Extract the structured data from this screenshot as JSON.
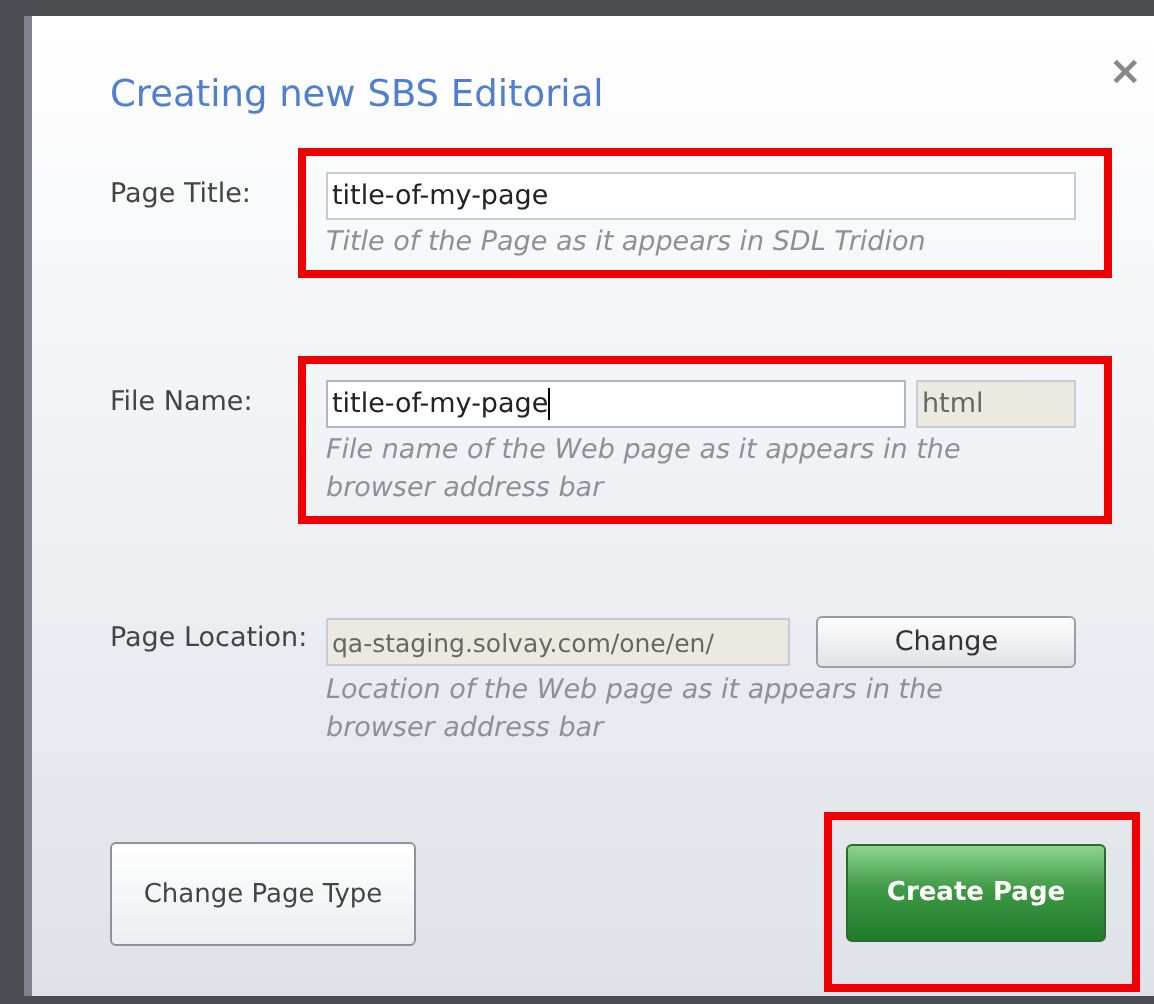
{
  "dialog": {
    "title": "Creating new SBS Editorial",
    "close": "×",
    "fields": [
      {
        "kind": "text",
        "label": "Page Title:",
        "value": "title-of-my-page",
        "focused": false,
        "hint": "Title of the Page as it appears in SDL Tridion",
        "highlighted": true
      },
      {
        "kind": "text_with_extension",
        "label": "File Name:",
        "value": "title-of-my-page",
        "extension": "html",
        "focused": true,
        "hint": "File name of the Web page as it appears in the browser address bar",
        "highlighted": true
      },
      {
        "kind": "location",
        "label": "Page Location:",
        "value": "qa-staging.solvay.com/one/en/",
        "button": "Change",
        "hint": "Location of the Web page as it appears in the browser address bar",
        "highlighted": false
      }
    ],
    "buttons": [
      {
        "label": "Change Page Type",
        "kind": "secondary",
        "highlighted": false
      },
      {
        "label": "Create Page",
        "kind": "primary",
        "highlighted": true
      }
    ]
  }
}
